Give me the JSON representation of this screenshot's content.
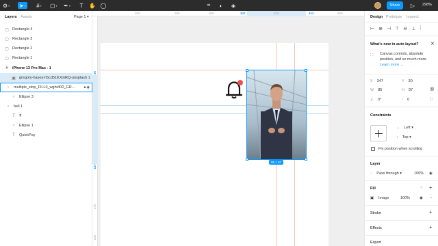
{
  "toolbar": {
    "share_label": "Share",
    "zoom_label": "298%"
  },
  "left_panel": {
    "tabs": [
      "Layers",
      "Assets"
    ],
    "page_selector": "Page 1",
    "layers": [
      {
        "label": "Rectangle 4",
        "icon": "rectangle-icon",
        "glyph": "▢"
      },
      {
        "label": "Rectangle 3",
        "icon": "rectangle-icon",
        "glyph": "▢"
      },
      {
        "label": "Rectangle 2",
        "icon": "rectangle-icon",
        "glyph": "▢"
      },
      {
        "label": "Rectangle 1",
        "icon": "rectangle-icon",
        "glyph": "▢"
      },
      {
        "label": "iPhone 13 Pro Max - 1",
        "icon": "frame-icon",
        "glyph": "#"
      },
      {
        "label": "gregory-hayes-h5cd51KXmRQ-unsplash 1",
        "icon": "image-icon",
        "glyph": "▣"
      },
      {
        "label": "multiple_stop_FILL0_wght400_GR...",
        "icon": "component-icon",
        "glyph": "⁞"
      },
      {
        "label": "Ellipse 3",
        "icon": "ellipse-icon",
        "glyph": "○"
      },
      {
        "label": "bell 1",
        "icon": "group-icon",
        "glyph": "⁞"
      },
      {
        "label": "₹",
        "icon": "text-icon",
        "glyph": "T"
      },
      {
        "label": "Ellipse 1",
        "icon": "ellipse-icon",
        "glyph": "○"
      },
      {
        "label": "QuickPay",
        "icon": "text-icon",
        "glyph": "T"
      }
    ]
  },
  "canvas": {
    "ruler_top": [
      "200",
      "250",
      "300",
      "347",
      "400",
      "412",
      "450"
    ],
    "ruler_left": [
      "30",
      "127",
      "175",
      "200"
    ],
    "dimension_badge": "85 × 97"
  },
  "right_panel": {
    "tabs": [
      "Design",
      "Prototype",
      "Inspect"
    ],
    "whats_new": {
      "title": "What's new in auto layout?",
      "body": "Canvas controls, absolute position, and so much more.",
      "link": "Learn more →"
    },
    "position": {
      "x": "347",
      "y": "30"
    },
    "size": {
      "w": "85",
      "h": "97"
    },
    "rotation": "0°",
    "radius": "0",
    "constraints": {
      "title": "Constraints",
      "horizontal": "Left",
      "vertical": "Top",
      "fix_position": "Fix position when scrolling"
    },
    "layer": {
      "title": "Layer",
      "blend": "Pass through",
      "opacity": "100%"
    },
    "fill": {
      "title": "Fill",
      "type": "Image",
      "opacity": "100%"
    },
    "stroke_title": "Stroke",
    "effects_title": "Effects",
    "export_title": "Export"
  },
  "colors": {
    "accent": "#0d99ff",
    "toolbar_bg": "#2c2c2c",
    "selected_layer": "#daebf7",
    "notification_dot": "#f24e4e"
  }
}
